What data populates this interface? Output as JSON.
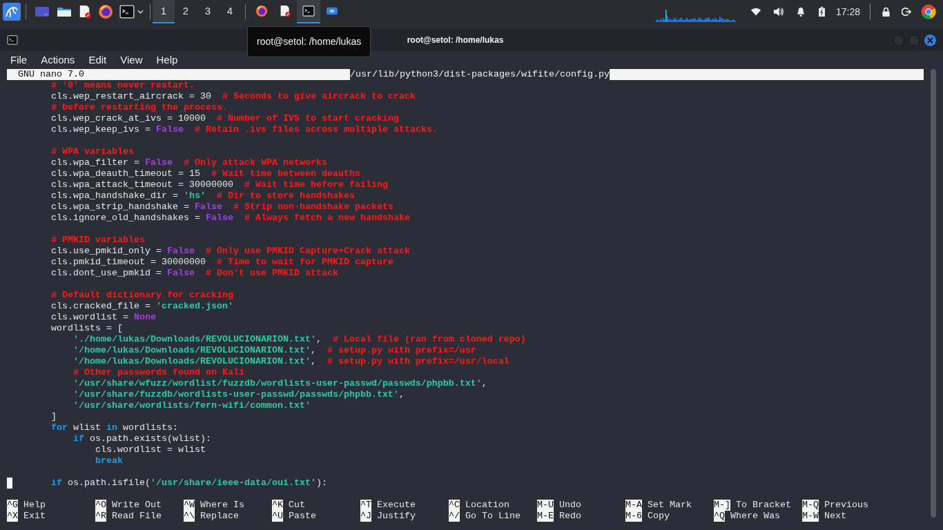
{
  "taskbar": {
    "workspaces": [
      {
        "label": "1",
        "selected": true
      },
      {
        "label": "2",
        "selected": false
      },
      {
        "label": "3",
        "selected": false
      },
      {
        "label": "4",
        "selected": false
      }
    ],
    "tasks": [
      {
        "kind": "firefox",
        "selected": false
      },
      {
        "kind": "editor",
        "selected": false
      },
      {
        "kind": "terminal",
        "selected": true
      },
      {
        "kind": "remote",
        "selected": false
      }
    ],
    "clock": "17:28"
  },
  "tooltip": "root@setol: /home/lukas",
  "window": {
    "title": "root@setol: /home/lukas",
    "menu": [
      "File",
      "Actions",
      "Edit",
      "View",
      "Help"
    ]
  },
  "editor": {
    "name": "GNU nano 7.0",
    "path": "/usr/lib/python3/dist-packages/wifite/config.py",
    "lines": [
      {
        "kind": "code",
        "tokens": [
          {
            "kind": "comment",
            "text": "        # '0' means never restart."
          }
        ]
      },
      {
        "kind": "code",
        "tokens": [
          {
            "kind": "text",
            "text": "        cls.wep_restart_aircrack = 30"
          },
          {
            "kind": "comment",
            "text": "  # Seconds to give aircrack to crack"
          }
        ]
      },
      {
        "kind": "code",
        "tokens": [
          {
            "kind": "comment",
            "text": "        # before restarting the process."
          }
        ]
      },
      {
        "kind": "code",
        "tokens": [
          {
            "kind": "text",
            "text": "        cls.wep_crack_at_ivs = 10000"
          },
          {
            "kind": "comment",
            "text": "  # Number of IVS to start cracking"
          }
        ]
      },
      {
        "kind": "code",
        "tokens": [
          {
            "kind": "text",
            "text": "        cls.wep_keep_ivs = "
          },
          {
            "kind": "constant",
            "text": "False"
          },
          {
            "kind": "comment",
            "text": "  # Retain .ivs files across multiple attacks."
          }
        ]
      },
      {
        "kind": "blank"
      },
      {
        "kind": "code",
        "tokens": [
          {
            "kind": "comment",
            "text": "        # WPA variables"
          }
        ]
      },
      {
        "kind": "code",
        "tokens": [
          {
            "kind": "text",
            "text": "        cls.wpa_filter = "
          },
          {
            "kind": "constant",
            "text": "False"
          },
          {
            "kind": "comment",
            "text": "  # Only attack WPA networks"
          }
        ]
      },
      {
        "kind": "code",
        "tokens": [
          {
            "kind": "text",
            "text": "        cls.wpa_deauth_timeout = 15"
          },
          {
            "kind": "comment",
            "text": "  # Wait time between deauths"
          }
        ]
      },
      {
        "kind": "code",
        "tokens": [
          {
            "kind": "text",
            "text": "        cls.wpa_attack_timeout = 30000000"
          },
          {
            "kind": "comment",
            "text": "  # Wait time before failing"
          }
        ]
      },
      {
        "kind": "code",
        "tokens": [
          {
            "kind": "text",
            "text": "        cls.wpa_handshake_dir = "
          },
          {
            "kind": "string",
            "text": "'hs'"
          },
          {
            "kind": "comment",
            "text": "  # Dir to store handshakes"
          }
        ]
      },
      {
        "kind": "code",
        "tokens": [
          {
            "kind": "text",
            "text": "        cls.wpa_strip_handshake = "
          },
          {
            "kind": "constant",
            "text": "False"
          },
          {
            "kind": "comment",
            "text": "  # Strip non-handshake packets"
          }
        ]
      },
      {
        "kind": "code",
        "tokens": [
          {
            "kind": "text",
            "text": "        cls.ignore_old_handshakes = "
          },
          {
            "kind": "constant",
            "text": "False"
          },
          {
            "kind": "comment",
            "text": "  # Always fetch a new handshake"
          }
        ]
      },
      {
        "kind": "blank"
      },
      {
        "kind": "code",
        "tokens": [
          {
            "kind": "comment",
            "text": "        # PMKID variables"
          }
        ]
      },
      {
        "kind": "code",
        "tokens": [
          {
            "kind": "text",
            "text": "        cls.use_pmkid_only = "
          },
          {
            "kind": "constant",
            "text": "False"
          },
          {
            "kind": "comment",
            "text": "  # Only use PMKID Capture+Crack attack"
          }
        ]
      },
      {
        "kind": "code",
        "tokens": [
          {
            "kind": "text",
            "text": "        cls.pmkid_timeout = 30000000"
          },
          {
            "kind": "comment",
            "text": "  # Time to wait for PMKID capture"
          }
        ]
      },
      {
        "kind": "code",
        "tokens": [
          {
            "kind": "text",
            "text": "        cls.dont_use_pmkid = "
          },
          {
            "kind": "constant",
            "text": "False"
          },
          {
            "kind": "comment",
            "text": "  # Don't use PMKID attack"
          }
        ]
      },
      {
        "kind": "blank"
      },
      {
        "kind": "code",
        "tokens": [
          {
            "kind": "comment",
            "text": "        # Default dictionary for cracking"
          }
        ]
      },
      {
        "kind": "code",
        "tokens": [
          {
            "kind": "text",
            "text": "        cls.cracked_file = "
          },
          {
            "kind": "string",
            "text": "'cracked.json'"
          }
        ]
      },
      {
        "kind": "code",
        "tokens": [
          {
            "kind": "text",
            "text": "        cls.wordlist = "
          },
          {
            "kind": "constant",
            "text": "None"
          }
        ]
      },
      {
        "kind": "code",
        "tokens": [
          {
            "kind": "text",
            "text": "        wordlists = ["
          }
        ]
      },
      {
        "kind": "code",
        "tokens": [
          {
            "kind": "string",
            "text": "            './home/lukas/Downloads/REVOLUCIONARION.txt'"
          },
          {
            "kind": "text",
            "text": ","
          },
          {
            "kind": "comment",
            "text": "  # Local file (ran from cloned repo)"
          }
        ]
      },
      {
        "kind": "code",
        "tokens": [
          {
            "kind": "string",
            "text": "            '/home/lukas/Downloads/REVOLUCIONARION.txt'"
          },
          {
            "kind": "text",
            "text": ","
          },
          {
            "kind": "comment",
            "text": "  # setup.py with prefix=/usr"
          }
        ]
      },
      {
        "kind": "code",
        "tokens": [
          {
            "kind": "string",
            "text": "            '/home/lukas/Downloads/REVOLUCIONARION.txt'"
          },
          {
            "kind": "text",
            "text": ","
          },
          {
            "kind": "comment",
            "text": "  # setup.py with prefix=/usr/local"
          }
        ]
      },
      {
        "kind": "code",
        "tokens": [
          {
            "kind": "comment",
            "text": "            # Other passwords found on Kali"
          }
        ]
      },
      {
        "kind": "code",
        "tokens": [
          {
            "kind": "string",
            "text": "            '/usr/share/wfuzz/wordlist/fuzzdb/wordlists-user-passwd/passwds/phpbb.txt'"
          },
          {
            "kind": "text",
            "text": ","
          }
        ]
      },
      {
        "kind": "code",
        "tokens": [
          {
            "kind": "string",
            "text": "            '/usr/share/fuzzdb/wordlists-user-passwd/passwds/phpbb.txt'"
          },
          {
            "kind": "text",
            "text": ","
          }
        ]
      },
      {
        "kind": "code",
        "tokens": [
          {
            "kind": "string",
            "text": "            '/usr/share/wordlists/fern-wifi/common.txt'"
          }
        ]
      },
      {
        "kind": "code",
        "tokens": [
          {
            "kind": "text",
            "text": "        ]"
          }
        ]
      },
      {
        "kind": "code",
        "tokens": [
          {
            "kind": "keyword",
            "text": "        for"
          },
          {
            "kind": "text",
            "text": " wlist "
          },
          {
            "kind": "keyword",
            "text": "in"
          },
          {
            "kind": "text",
            "text": " wordlists:"
          }
        ]
      },
      {
        "kind": "code",
        "tokens": [
          {
            "kind": "keyword",
            "text": "            if"
          },
          {
            "kind": "text",
            "text": " os.path.exists(wlist):"
          }
        ]
      },
      {
        "kind": "code",
        "tokens": [
          {
            "kind": "text",
            "text": "                cls.wordlist = wlist"
          }
        ]
      },
      {
        "kind": "code",
        "tokens": [
          {
            "kind": "keyword",
            "text": "                break"
          }
        ]
      },
      {
        "kind": "blank"
      },
      {
        "kind": "code",
        "cursor": true,
        "tokens": [
          {
            "kind": "keyword",
            "text": "        if"
          },
          {
            "kind": "text",
            "text": " os.path.isfile("
          },
          {
            "kind": "string",
            "text": "'/usr/share/ieee-data/oui.txt'"
          },
          {
            "kind": "text",
            "text": "):"
          }
        ]
      }
    ],
    "shortcut_columns": [
      {
        "items": [
          {
            "key": "^G",
            "label": "Help"
          },
          {
            "key": "^X",
            "label": "Exit"
          }
        ]
      },
      {
        "items": [
          {
            "key": "^O",
            "label": "Write Out"
          },
          {
            "key": "^R",
            "label": "Read File"
          }
        ]
      },
      {
        "items": [
          {
            "key": "^W",
            "label": "Where Is"
          },
          {
            "key": "^\\",
            "label": "Replace"
          }
        ]
      },
      {
        "items": [
          {
            "key": "^K",
            "label": "Cut"
          },
          {
            "key": "^U",
            "label": "Paste"
          }
        ]
      },
      {
        "items": [
          {
            "key": "^T",
            "label": "Execute"
          },
          {
            "key": "^J",
            "label": "Justify"
          }
        ]
      },
      {
        "items": [
          {
            "key": "^C",
            "label": "Location"
          },
          {
            "key": "^/",
            "label": "Go To Line"
          }
        ]
      },
      {
        "items": [
          {
            "key": "M-U",
            "label": "Undo"
          },
          {
            "key": "M-E",
            "label": "Redo"
          }
        ]
      },
      {
        "items": [
          {
            "key": "M-A",
            "label": "Set Mark"
          },
          {
            "key": "M-6",
            "label": "Copy"
          }
        ]
      },
      {
        "items": [
          {
            "key": "M-]",
            "label": "To Bracket"
          },
          {
            "key": "^Q",
            "label": "Where Was"
          }
        ]
      },
      {
        "items": [
          {
            "key": "M-Q",
            "label": "Previous"
          },
          {
            "key": "M-W",
            "label": "Next"
          }
        ]
      }
    ]
  }
}
